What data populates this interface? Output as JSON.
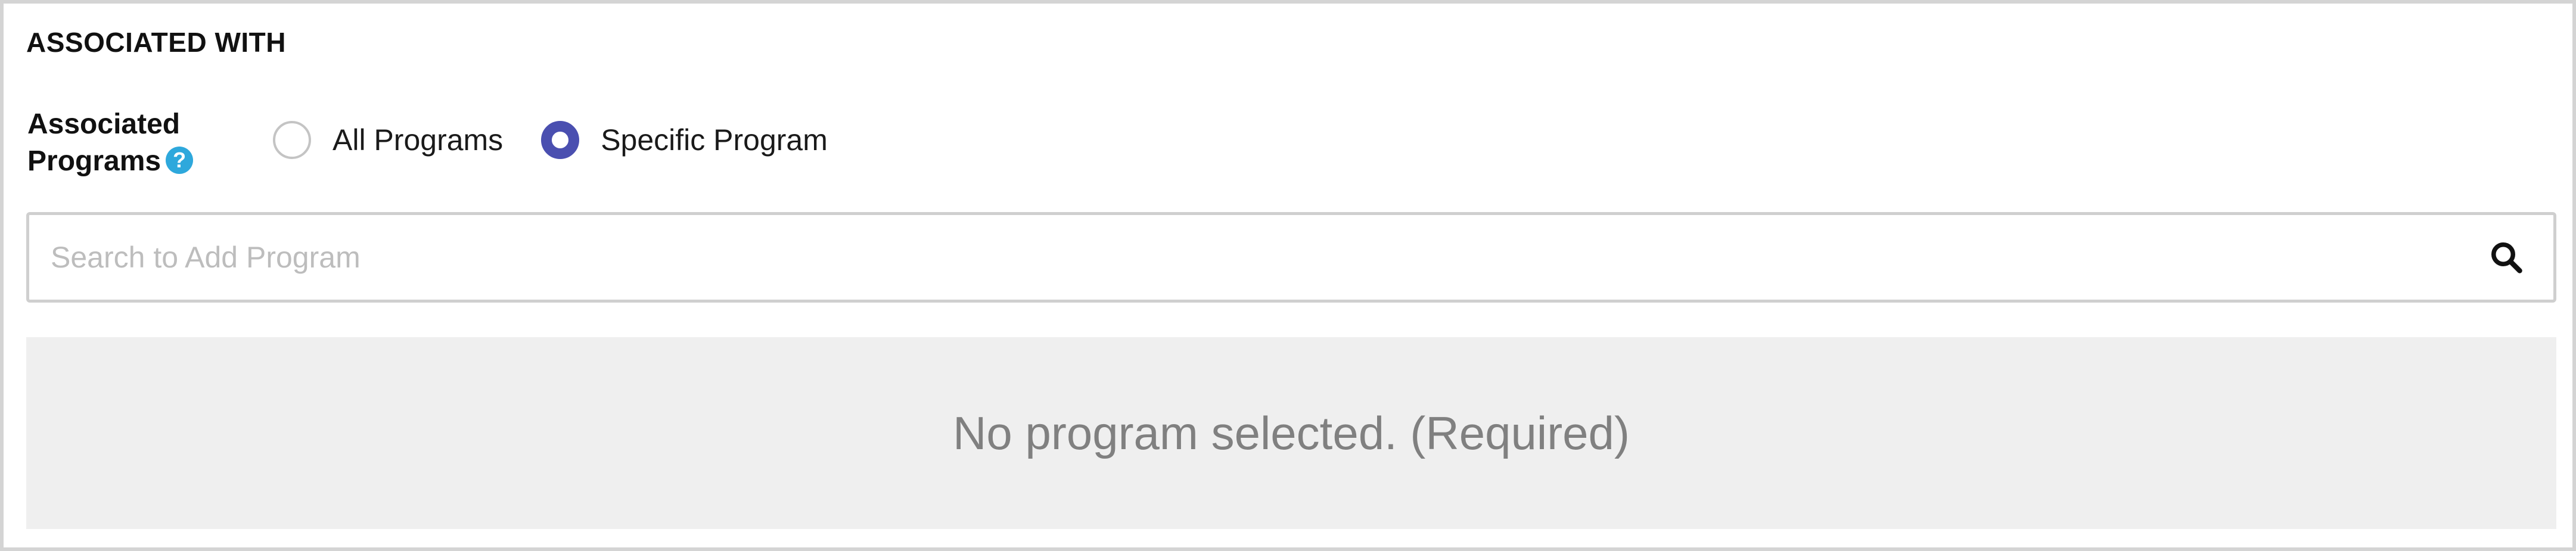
{
  "section": {
    "title": "ASSOCIATED WITH"
  },
  "associated_programs": {
    "label": "Associated Programs",
    "help_icon_symbol": "?",
    "help_icon": "question-circle-icon",
    "options": [
      {
        "label": "All Programs",
        "checked": false
      },
      {
        "label": "Specific Program",
        "checked": true
      }
    ],
    "selected": "Specific Program"
  },
  "search": {
    "placeholder": "Search to Add Program",
    "value": "",
    "icon": "magnifier-icon"
  },
  "empty_state": {
    "message": "No program selected. (Required)"
  },
  "colors": {
    "radio_checked": "#4a4fb0",
    "help_icon": "#2ea8dc",
    "empty_state_bg": "#efefef",
    "border": "#d4d4d4"
  }
}
